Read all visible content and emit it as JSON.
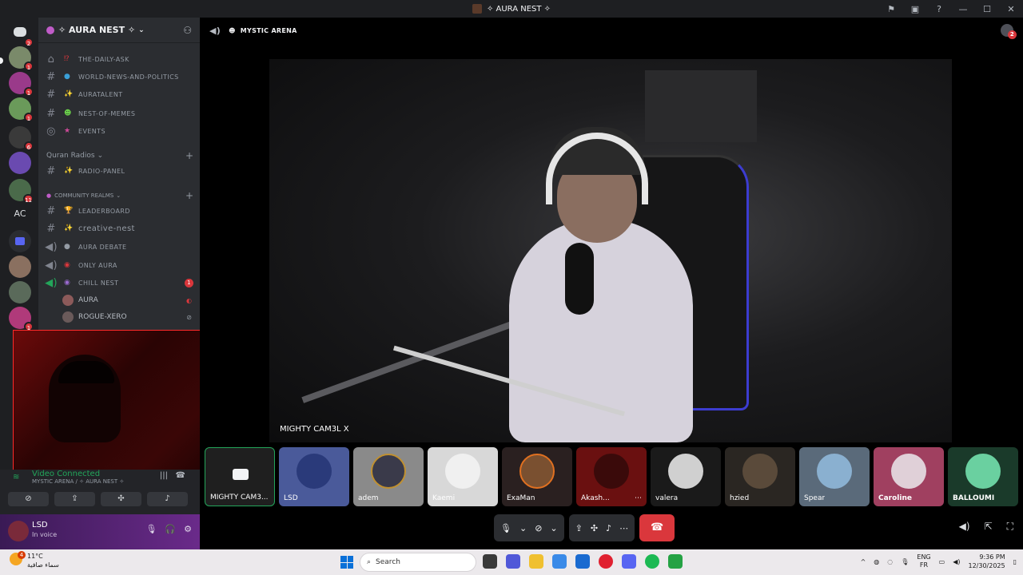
{
  "window": {
    "title": "✧ AURA NEST ✧"
  },
  "server": {
    "name": "✧ AURA NEST ✧"
  },
  "rail": {
    "badges": [
      "2",
      "1",
      "1",
      "1",
      "6",
      "11",
      "1",
      "1"
    ],
    "ac_label": "AC"
  },
  "channels": {
    "top": [
      {
        "name": "THE-DAILY-ASK",
        "emoji": "⁉"
      },
      {
        "name": "WORLD-NEWS-AND-POLITICS",
        "emoji": "●"
      },
      {
        "name": "AURATALENT",
        "emoji": "✨"
      },
      {
        "name": "NEST-OF-MEMES",
        "emoji": "☻"
      },
      {
        "name": "EVENTS",
        "emoji": "★"
      }
    ],
    "cat_quran": "Quran Radios",
    "quran": [
      {
        "name": "RADIO-PANEL",
        "emoji": "✨"
      }
    ],
    "cat_community": "COMMUNITY REALMS",
    "community": [
      {
        "name": "LEADERBOARD",
        "emoji": "🏆"
      },
      {
        "name": "creative-nest",
        "emoji": "✨"
      },
      {
        "name": "AURA DEBATE",
        "emoji": "●"
      },
      {
        "name": "ONLY AURA",
        "emoji": "◉"
      },
      {
        "name": "CHILL NEST",
        "emoji": "◉",
        "badge": "1"
      }
    ],
    "voice_users": [
      "AURA",
      "ROGUE-XERO"
    ]
  },
  "voice_panel": {
    "status": "Video Connected",
    "location": "MYSTIC ARENA / ✧ AURA NEST ✧"
  },
  "user": {
    "name": "LSD",
    "status": "In voice"
  },
  "call": {
    "channel": "MYSTIC ARENA",
    "stage_name": "MIGHTY CAM3L X",
    "participants": [
      "MIGHTY CAM3...",
      "LSD",
      "adem",
      "Kaemi",
      "ExaMan",
      "Akash...",
      "valera",
      "hzied",
      "Spear",
      "Caroline",
      "BALLOUMI"
    ],
    "inbox_badge": "2"
  },
  "taskbar": {
    "temp": "11°C",
    "condition": "سماء صافية",
    "weather_badge": "4",
    "search_placeholder": "Search",
    "lang_top": "ENG",
    "lang_bottom": "FR",
    "time": "9:36 PM",
    "date": "12/30/2025"
  },
  "colors": {
    "accent_green": "#23a55a",
    "danger": "#da373c",
    "blurple": "#5865f2"
  }
}
